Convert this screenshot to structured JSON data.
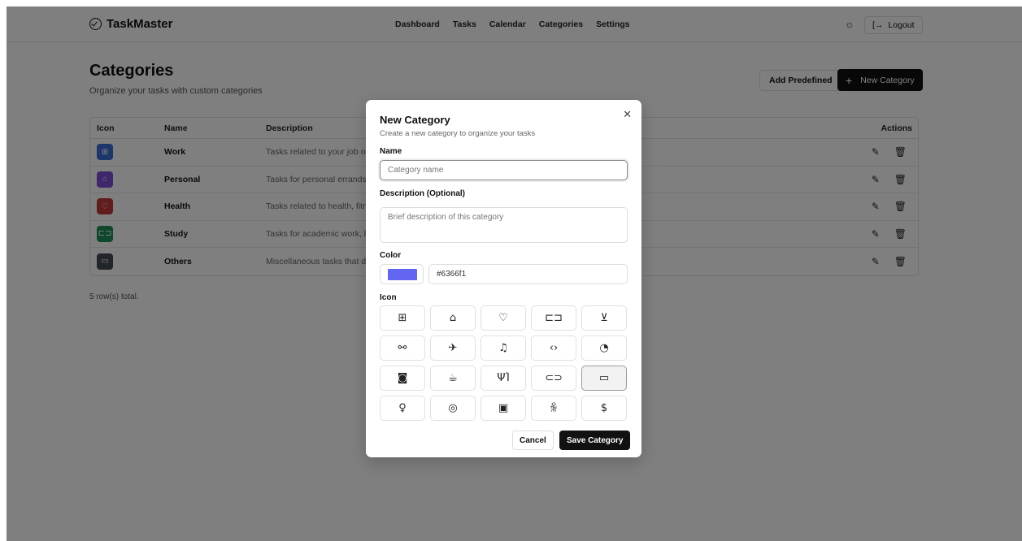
{
  "header": {
    "brand": "TaskMaster",
    "nav": [
      "Dashboard",
      "Tasks",
      "Calendar",
      "Categories",
      "Settings"
    ],
    "logout_label": "Logout"
  },
  "page": {
    "title": "Categories",
    "subtitle": "Organize your tasks with custom categories",
    "add_predefined_label": "Add Predefined",
    "new_category_label": "New Category",
    "row_count": "5 row(s) total."
  },
  "table": {
    "columns": [
      "Icon",
      "Name",
      "Description",
      "Actions"
    ],
    "rows": [
      {
        "name": "Work",
        "description": "Tasks related to your job or pr",
        "color": "#3b6fd6",
        "icon": "briefcase-icon",
        "glyph": "⊞"
      },
      {
        "name": "Personal",
        "description": "Tasks for personal errands, ho",
        "color": "#7e4fd6",
        "icon": "house-icon",
        "glyph": "⌂"
      },
      {
        "name": "Health",
        "description": "Tasks related to health, fitness",
        "color": "#c23b3b",
        "icon": "heart-icon",
        "glyph": "♡"
      },
      {
        "name": "Study",
        "description": "Tasks for academic work, lear",
        "color": "#1f8f5a",
        "icon": "book-icon",
        "glyph": "⊏⊐"
      },
      {
        "name": "Others",
        "description": "Miscellaneous tasks that don'",
        "color": "#444a55",
        "icon": "folder-icon",
        "glyph": "▭"
      }
    ]
  },
  "dialog": {
    "title": "New Category",
    "description": "Create a new category to organize your tasks",
    "name_label": "Name",
    "name_placeholder": "Category name",
    "desc_label": "Description (Optional)",
    "desc_placeholder": "Brief description of this category",
    "color_label": "Color",
    "color_value": "#6366f1",
    "icon_label": "Icon",
    "icons": [
      {
        "name": "briefcase-icon",
        "glyph": "⊞"
      },
      {
        "name": "house-icon",
        "glyph": "⌂"
      },
      {
        "name": "heart-icon",
        "glyph": "♡"
      },
      {
        "name": "book-open-icon",
        "glyph": "⊏⊐"
      },
      {
        "name": "shopping-cart-icon",
        "glyph": "⊻"
      },
      {
        "name": "dumbbell-icon",
        "glyph": "⚯"
      },
      {
        "name": "plane-icon",
        "glyph": "✈"
      },
      {
        "name": "music-icon",
        "glyph": "♫"
      },
      {
        "name": "code-icon",
        "glyph": "‹›"
      },
      {
        "name": "palette-icon",
        "glyph": "◔"
      },
      {
        "name": "camera-icon",
        "glyph": "◙"
      },
      {
        "name": "coffee-icon",
        "glyph": "☕"
      },
      {
        "name": "utensils-icon",
        "glyph": "ΨΊ"
      },
      {
        "name": "car-icon",
        "glyph": "⊂⊃"
      },
      {
        "name": "folder-icon",
        "glyph": "▭"
      },
      {
        "name": "lightbulb-icon",
        "glyph": "♀"
      },
      {
        "name": "target-icon",
        "glyph": "◎"
      },
      {
        "name": "calendar-icon",
        "glyph": "▣"
      },
      {
        "name": "users-icon",
        "glyph": "ꆜ"
      },
      {
        "name": "dollar-icon",
        "glyph": "$"
      }
    ],
    "selected_icon": "folder-icon",
    "cancel_label": "Cancel",
    "save_label": "Save Category"
  }
}
